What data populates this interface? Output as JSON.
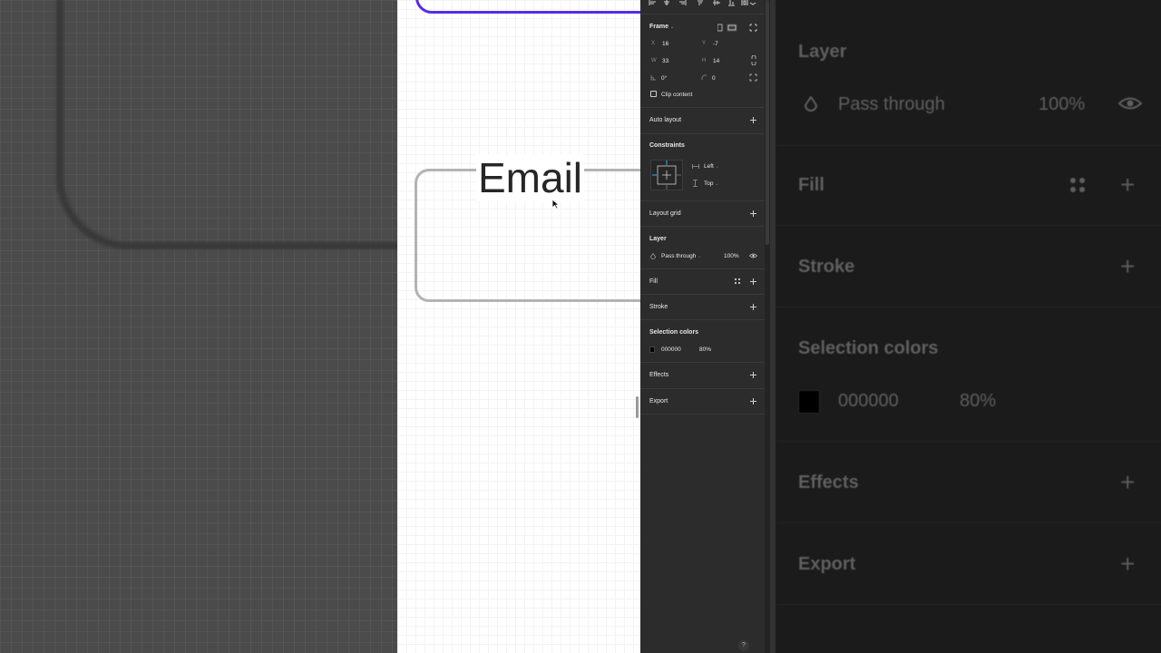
{
  "panel": {
    "frame": {
      "title": "Frame",
      "x_label": "X",
      "x_value": "16",
      "y_label": "Y",
      "y_value": "-7",
      "w_label": "W",
      "w_value": "33",
      "h_label": "H",
      "h_value": "14",
      "rotation_value": "0°",
      "radius_value": "0",
      "clip_content_label": "Clip content"
    },
    "auto_layout": {
      "title": "Auto layout"
    },
    "constraints": {
      "title": "Constraints",
      "horizontal": "Left",
      "vertical": "Top"
    },
    "layout_grid": {
      "title": "Layout grid"
    },
    "layer": {
      "title": "Layer",
      "blend_mode": "Pass through",
      "opacity": "100%"
    },
    "fill": {
      "title": "Fill"
    },
    "stroke": {
      "title": "Stroke"
    },
    "selection_colors": {
      "title": "Selection colors",
      "hex": "000000",
      "opacity": "80%"
    },
    "effects": {
      "title": "Effects"
    },
    "export": {
      "title": "Export"
    },
    "help": "?"
  },
  "canvas": {
    "email_label": "Email"
  },
  "colors": {
    "panel_bg": "#2c2c2c",
    "accent_purple": "#5a2be3",
    "input_border": "#b3b3b3",
    "selection_swatch": "#000000"
  }
}
